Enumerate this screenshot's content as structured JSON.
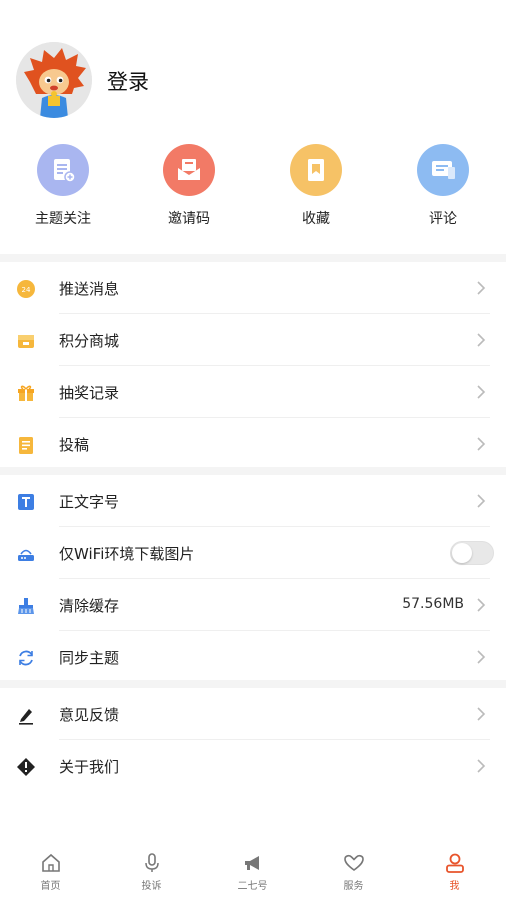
{
  "colors": {
    "accent": "#e8542b",
    "topic_icon_bg": "#a9b6f0",
    "invite_icon_bg": "#f27a66",
    "favorite_icon_bg": "#f6c266",
    "comment_icon_bg": "#8dbbf2"
  },
  "profile": {
    "login_label": "登录"
  },
  "quick_actions": [
    {
      "label": "主题关注",
      "icon": "topic-follow-icon"
    },
    {
      "label": "邀请码",
      "icon": "invite-code-icon"
    },
    {
      "label": "收藏",
      "icon": "favorite-icon"
    },
    {
      "label": "评论",
      "icon": "comment-icon"
    }
  ],
  "section1": [
    {
      "label": "推送消息",
      "icon": "push-message-icon"
    },
    {
      "label": "积分商城",
      "icon": "points-mall-icon"
    },
    {
      "label": "抽奖记录",
      "icon": "lottery-gift-icon"
    },
    {
      "label": "投稿",
      "icon": "contribute-icon"
    }
  ],
  "section2": [
    {
      "label": "正文字号",
      "icon": "font-size-icon"
    },
    {
      "label": "仅WiFi环境下载图片",
      "icon": "wifi-router-icon",
      "toggle_on": false
    },
    {
      "label": "清除缓存",
      "icon": "clear-cache-icon",
      "value": "57.56MB"
    },
    {
      "label": "同步主题",
      "icon": "sync-icon"
    }
  ],
  "section3": [
    {
      "label": "意见反馈",
      "icon": "feedback-pen-icon"
    },
    {
      "label": "关于我们",
      "icon": "about-icon"
    }
  ],
  "tabbar": [
    {
      "label": "首页",
      "icon": "home-icon",
      "active": false
    },
    {
      "label": "投诉",
      "icon": "microphone-icon",
      "active": false
    },
    {
      "label": "二七号",
      "icon": "megaphone-icon",
      "active": false
    },
    {
      "label": "服务",
      "icon": "heart-hands-icon",
      "active": false
    },
    {
      "label": "我",
      "icon": "user-icon",
      "active": true
    }
  ]
}
